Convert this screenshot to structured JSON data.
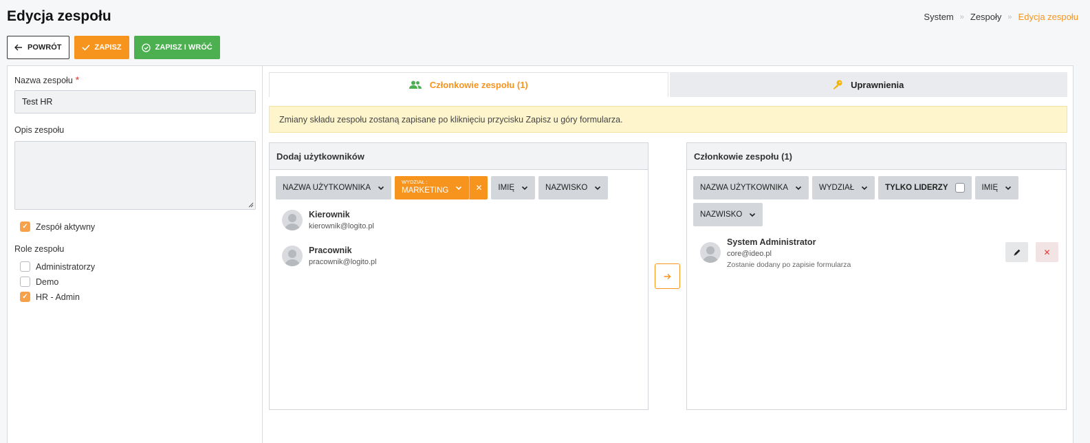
{
  "header": {
    "title": "Edycja zespołu",
    "breadcrumb": [
      "System",
      "Zespoły",
      "Edycja zespołu"
    ]
  },
  "toolbar": {
    "back_label": "POWRÓT",
    "save_label": "ZAPISZ",
    "save_back_label": "ZAPISZ I WRÓĆ"
  },
  "form": {
    "name_label": "Nazwa zespołu",
    "required_mark": "*",
    "name_value": "Test HR",
    "description_label": "Opis zespołu",
    "description_value": "",
    "active_label": "Zespół aktywny",
    "active_checked": true,
    "roles_label": "Role zespołu",
    "roles": [
      {
        "label": "Administratorzy",
        "checked": false
      },
      {
        "label": "Demo",
        "checked": false
      },
      {
        "label": "HR - Admin",
        "checked": true
      }
    ]
  },
  "tabs": [
    {
      "label": "Członkowie zespołu (1)",
      "icon": "users-icon",
      "active": true
    },
    {
      "label": "Uprawnienia",
      "icon": "key-icon",
      "active": false
    }
  ],
  "notice": "Zmiany składu zespołu zostaną zapisane po kliknięciu przycisku Zapisz u góry formularza.",
  "add_panel": {
    "title": "Dodaj użytkowników",
    "filters": {
      "username": "NAZWA UŻYTKOWNIKA",
      "department_key": "WYDZIAŁ :",
      "department_value": "MARKETING",
      "first_name": "IMIĘ",
      "last_name": "NAZWISKO"
    },
    "users": [
      {
        "name": "Kierownik",
        "email": "kierownik@logito.pl"
      },
      {
        "name": "Pracownik",
        "email": "pracownik@logito.pl"
      }
    ]
  },
  "members_panel": {
    "title": "Członkowie zespołu (1)",
    "filters": {
      "username": "NAZWA UŻYTKOWNIKA",
      "department": "WYDZIAŁ",
      "leaders_only": "TYLKO LIDERZY",
      "first_name": "IMIĘ",
      "last_name": "NAZWISKO"
    },
    "members": [
      {
        "name": "System Administrator",
        "email": "core@ideo.pl",
        "note": "Zostanie dodany po zapisie formularza"
      }
    ]
  },
  "colors": {
    "accent": "#f7941d",
    "success": "#4caf50",
    "danger": "#e53935",
    "notice_bg": "#fff5cc"
  }
}
